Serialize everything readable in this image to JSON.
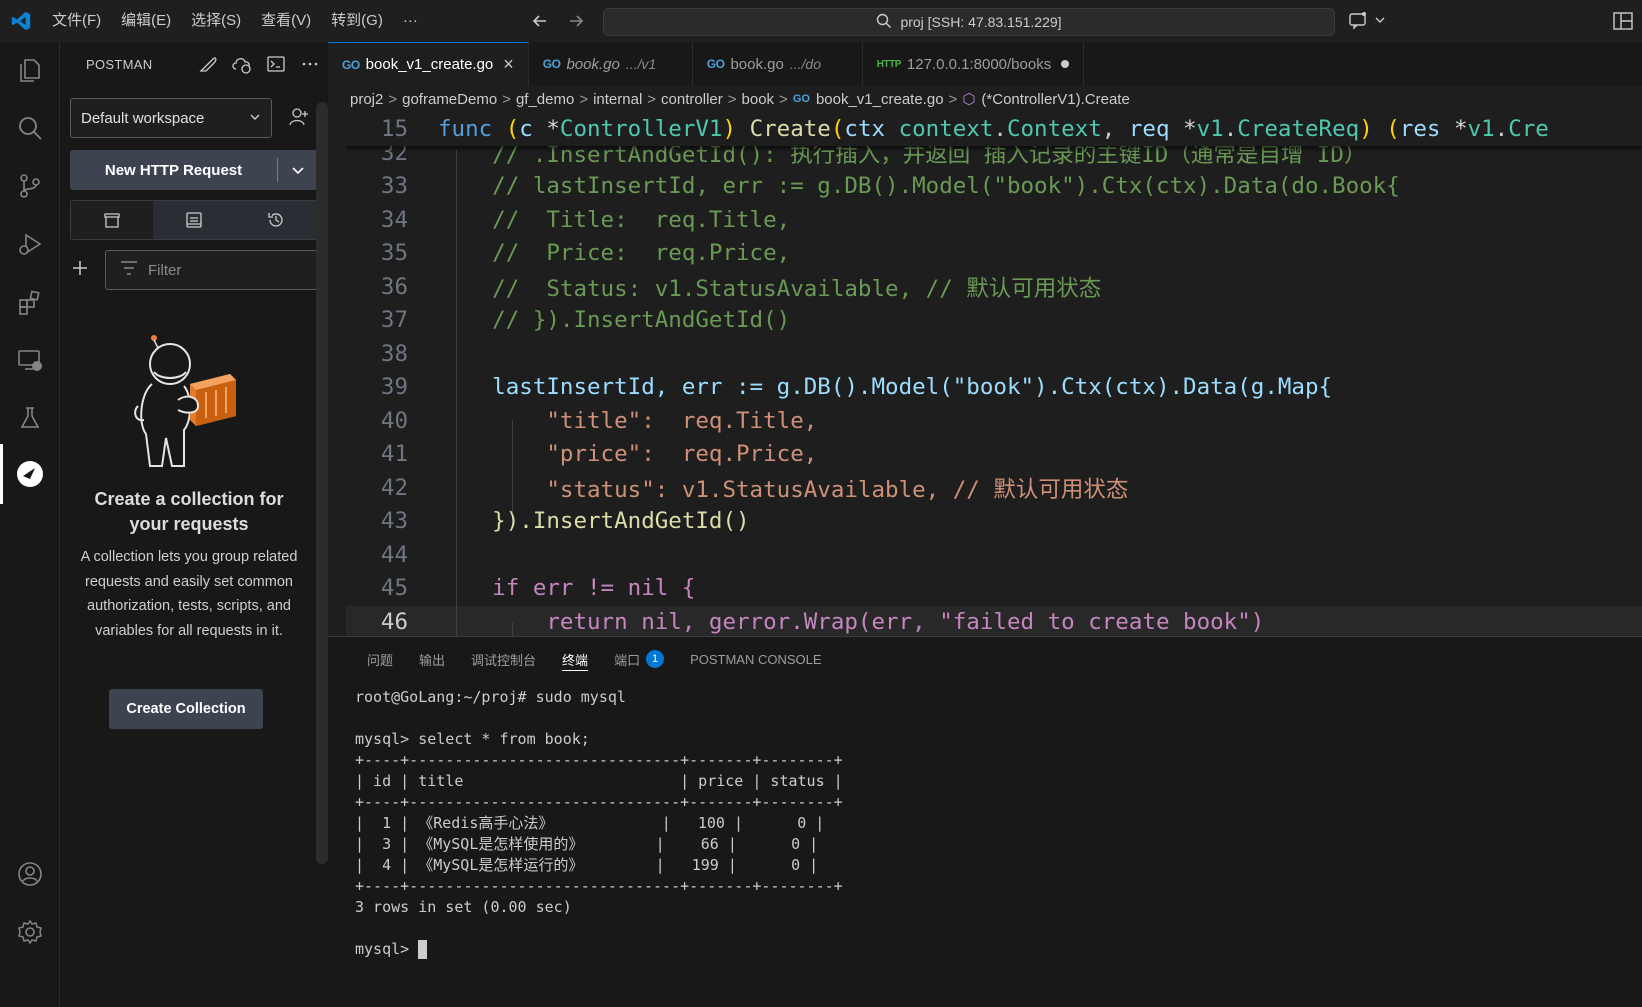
{
  "titlebar": {
    "menu": [
      "文件(F)",
      "编辑(E)",
      "选择(S)",
      "查看(V)",
      "转到(G)",
      "···"
    ],
    "search_text": "proj [SSH: 47.83.151.229]"
  },
  "sidebar": {
    "title": "POSTMAN",
    "workspace": "Default workspace",
    "new_request": "New HTTP Request",
    "filter_placeholder": "Filter",
    "empty_title": "Create a collection for your requests",
    "empty_desc": "A collection lets you group related requests and easily set common authorization, tests, scripts, and variables for all requests in it.",
    "create_collection": "Create Collection"
  },
  "tabs": [
    {
      "label": "book_v1_create.go",
      "desc": "",
      "icon": "GO",
      "active": true
    },
    {
      "label": "book.go",
      "desc": ".../v1",
      "icon": "GO",
      "active": false
    },
    {
      "label": "book.go",
      "desc": ".../do",
      "icon": "GO",
      "active": false
    },
    {
      "label": "127.0.0.1:8000/books",
      "desc": "",
      "icon": "HTTP",
      "active": false
    }
  ],
  "breadcrumbs": [
    "proj2",
    "goframeDemo",
    "gf_demo",
    "internal",
    "controller",
    "book",
    "book_v1_create.go",
    "(*ControllerV1).Create"
  ],
  "code": {
    "sticky_line": {
      "num": "15",
      "text": "func (c *ControllerV1) Create(ctx context.Context, req *v1.CreateReq) (res *v1.Cre"
    },
    "lines": [
      {
        "num": "32",
        "text": "    // .InsertAndGetId(): 执行插入，并返回 插入记录的主键ID（通常是自增 ID）"
      },
      {
        "num": "33",
        "text": "    // lastInsertId, err := g.DB().Model(\"book\").Ctx(ctx).Data(do.Book{"
      },
      {
        "num": "34",
        "text": "    //  Title:  req.Title,"
      },
      {
        "num": "35",
        "text": "    //  Price:  req.Price,"
      },
      {
        "num": "36",
        "text": "    //  Status: v1.StatusAvailable, // 默认可用状态"
      },
      {
        "num": "37",
        "text": "    // }).InsertAndGetId()"
      },
      {
        "num": "38",
        "text": ""
      },
      {
        "num": "39",
        "text": "    lastInsertId, err := g.DB().Model(\"book\").Ctx(ctx).Data(g.Map{"
      },
      {
        "num": "40",
        "text": "        \"title\":  req.Title,"
      },
      {
        "num": "41",
        "text": "        \"price\":  req.Price,"
      },
      {
        "num": "42",
        "text": "        \"status\": v1.StatusAvailable, // 默认可用状态"
      },
      {
        "num": "43",
        "text": "    }).InsertAndGetId()"
      },
      {
        "num": "44",
        "text": ""
      },
      {
        "num": "45",
        "text": "    if err != nil {"
      },
      {
        "num": "46",
        "text": "        return nil, gerror.Wrap(err, \"failed to create book\")"
      }
    ]
  },
  "panel": {
    "tabs": [
      "问题",
      "输出",
      "调试控制台",
      "终端",
      "端口",
      "POSTMAN CONSOLE"
    ],
    "active_tab": "终端",
    "ports_badge": "1",
    "terminal_lines": [
      "root@GoLang:~/proj# sudo mysql",
      "",
      "mysql> select * from book;",
      "+----+------------------------------+-------+--------+",
      "| id | title                        | price | status |",
      "+----+------------------------------+-------+--------+",
      "|  1 | 《Redis高手心法》            |   100 |      0 |",
      "|  3 | 《MySQL是怎样使用的》        |    66 |      0 |",
      "|  4 | 《MySQL是怎样运行的》        |   199 |      0 |",
      "+----+------------------------------+-------+--------+",
      "3 rows in set (0.00 sec)",
      "",
      "mysql> "
    ]
  },
  "colors": {
    "accent": "#0078d4",
    "keyword": "#c586c0",
    "function": "#dcdcaa",
    "type": "#4ec9b0",
    "variable": "#9cdcfe",
    "string": "#ce9178",
    "comment": "#6a9955"
  }
}
